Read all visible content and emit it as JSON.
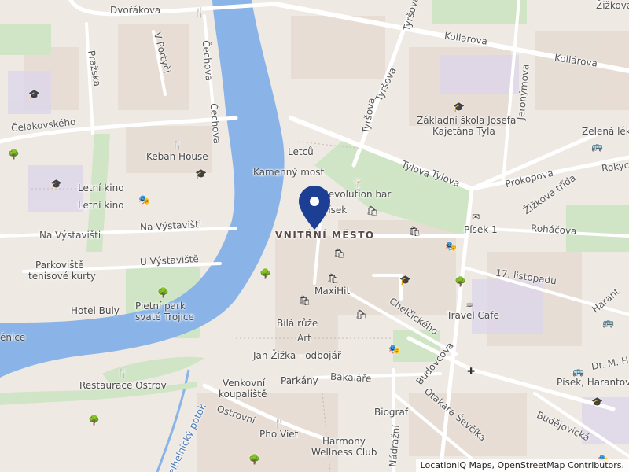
{
  "attribution": "LocationIQ Maps, OpenStreetMap Contributors.",
  "colors": {
    "water": "#8ab4e8",
    "park": "#cfe5c5",
    "block": "#e6dcd3",
    "road": "#ffffff",
    "pin": "#1c3f94",
    "background": "#efe9e3"
  },
  "district": "VNITŘNÍ MĚSTO",
  "streets": {
    "dvorakova": "Dvořákova",
    "prazska": "Pražská",
    "v_portyci": "V Portyči",
    "cechova_1": "Čechova",
    "cechova_2": "Čechova",
    "celakovskeho": "Čelakovského",
    "na_vystavisti_1": "Na Výstavišti",
    "na_vystavisti_2": "Na Výstavišti",
    "u_vystaviste": "U Výstaviště",
    "kollarova_1": "Kollárova",
    "kollarova_2": "Kollárova",
    "tyrsova_1": "Tyršova",
    "tyrsova_2": "Tyršova",
    "tyrsova_3": "Tyršova",
    "jeronymova": "Jeronýmova",
    "zizkova": "Žižkova",
    "tylova_1": "Tylova",
    "tylova_2": "Tylova",
    "prokopova": "Prokopova",
    "rokycanova": "Rokyc",
    "zizkova_trida": "Žižkova třída",
    "rohacova": "Roháčova",
    "listopadu": "17. listopadu",
    "harantova": "Harant",
    "dr_m_h": "Dr. M. H",
    "chelcickeho": "Chelčického",
    "budovcova": "Budovcova",
    "otakara_sevcika": "Otakara Ševčíka",
    "bakalare": "Bakaláře",
    "ostrovni": "Ostrovní",
    "nadrazni": "Nádražní",
    "budejovicka": "Budějovická",
    "smetanova_potok": "Šmelhelnický potok",
    "letcu": "Letců",
    "kamenny_most": "Kamenný most"
  },
  "pois": {
    "keban_house": "Keban House",
    "letni_kino_1": "Letní kino",
    "letni_kino_2": "Letní kino",
    "parkoviste": "Parkoviště",
    "tenisove_kurty": "tenisové kurty",
    "hotel_buly": "Hotel Buly",
    "pietni_park_1": "Pietní park",
    "pietni_park_2": "svaté Trojice",
    "restaurace_ostrov": "Restaurace Ostrov",
    "zakladni_skola_1": "Základní škola Josefa",
    "zakladni_skola_2": "Kajetána Tyla",
    "zelena_lekarna": "Zelená léka",
    "revolution_bar": "Revolution bar",
    "pisek": "Písek",
    "pisek_1": "Písek 1",
    "maxihit": "MaxiHit",
    "bila_ruze": "Bílá růže",
    "art": "Art",
    "jan_zizka": "Jan Žižka - odbojář",
    "travel_cafe": "Travel Cafe",
    "parkany": "Parkány",
    "venkovni_1": "Venkovní",
    "venkovni_2": "koupaliště",
    "biograf": "Biograf",
    "pho_viet": "Pho Viet",
    "harmony_1": "Harmony",
    "harmony_2": "Wellness Club",
    "pisek_harantova": "Písek, Harantova",
    "cenice": "ěnice"
  },
  "icons": {
    "restaurant": "🍴",
    "school": "🎓",
    "shop": "🛍",
    "bus": "🚌",
    "tree": "🌳",
    "bar": "🍸",
    "cafe": "☕",
    "pharmacy": "✚",
    "mail": "✉",
    "theatre": "🎭"
  }
}
